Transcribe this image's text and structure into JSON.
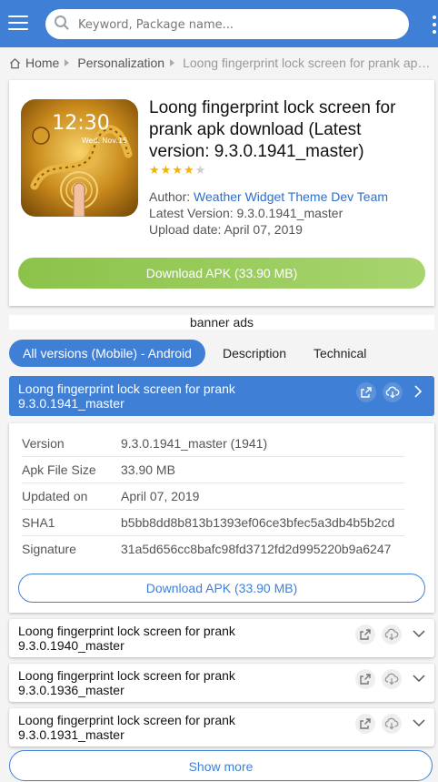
{
  "header": {
    "search_placeholder": "Keyword, Package name..."
  },
  "breadcrumb": {
    "home": "Home",
    "category": "Personalization",
    "current": "Loong fingerprint lock screen for prank apk download"
  },
  "app": {
    "title": "Loong fingerprint lock screen for prank apk download (Latest version: 9.3.0.1941_master)",
    "rating_stars": 4,
    "rating_max": 5,
    "author_label": "Author:",
    "author": "Weather Widget Theme Dev Team",
    "latest_version_label": "Latest Version:",
    "latest_version": "9.3.0.1941_master",
    "upload_date_label": "Upload date:",
    "upload_date": "April 07, 2019",
    "download_label": "Download APK (33.90 MB)",
    "icon_clock": "12:30",
    "icon_date": "Wed. Nov.15"
  },
  "ads": {
    "label": "banner ads"
  },
  "tabs": [
    {
      "label": "All versions (Mobile) - Android"
    },
    {
      "label": "Description"
    },
    {
      "label": "Technical"
    }
  ],
  "versions": [
    {
      "title": "Loong fingerprint lock screen for prank",
      "version": "9.3.0.1941_master"
    },
    {
      "title": "Loong fingerprint lock screen for prank",
      "version": "9.3.0.1940_master"
    },
    {
      "title": "Loong fingerprint lock screen for prank",
      "version": "9.3.0.1936_master"
    },
    {
      "title": "Loong fingerprint lock screen for prank",
      "version": "9.3.0.1931_master"
    }
  ],
  "details": {
    "rows": [
      {
        "key": "Version",
        "value": "9.3.0.1941_master (1941)"
      },
      {
        "key": "Apk File Size",
        "value": "33.90 MB"
      },
      {
        "key": "Updated on",
        "value": "April 07, 2019"
      },
      {
        "key": "SHA1",
        "value": "b5bb8dd8b813b1393ef06ce3bfec5a3db4b5b2cd"
      },
      {
        "key": "Signature",
        "value": "31a5d656cc8bafc98fd3712fd2d995220b9a6247"
      }
    ],
    "download_label": "Download APK (33.90 MB)"
  },
  "show_more_label": "Show more",
  "colors": {
    "primary": "#3f7fd6",
    "green": "#8bc34a",
    "star": "#f5b400"
  },
  "icons": [
    "menu-icon",
    "search-icon",
    "more-vert-icon",
    "home-icon",
    "external-link-icon",
    "cloud-download-icon",
    "chevron-right-icon",
    "chevron-down-icon",
    "star-icon"
  ]
}
